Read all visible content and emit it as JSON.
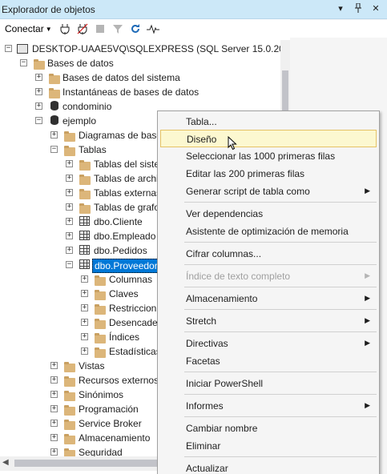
{
  "window": {
    "title": "Explorador de objetos",
    "title_icons": [
      "dropdown-icon",
      "pin-icon",
      "close-icon"
    ]
  },
  "toolbar": {
    "connect_label": "Conectar",
    "buttons": [
      "connect-plug-icon",
      "disconnect-icon",
      "stop-icon",
      "filter-icon",
      "refresh-icon",
      "activity-monitor-icon"
    ]
  },
  "tree": {
    "server": "DESKTOP-UAAE5VQ\\SQLEXPRESS (SQL Server 15.0.2000 -",
    "databases": "Bases de datos",
    "system_databases": "Bases de datos del sistema",
    "snapshots": "Instantáneas de bases de datos",
    "db_condominio": "condominio",
    "db_ejemplo": "ejemplo",
    "diagrams": "Diagramas de base",
    "tables": "Tablas",
    "system_tables": "Tablas del siste",
    "file_tables": "Tablas de archi",
    "external_tables": "Tablas externas",
    "graph_tables": "Tablas de grafo",
    "t_cliente": "dbo.Cliente",
    "t_empleado": "dbo.Empleado",
    "t_pedidos": "dbo.Pedidos",
    "t_proveedor": "dbo.Proveedor",
    "columns": "Columnas",
    "keys": "Claves",
    "constraints": "Restriccion",
    "triggers": "Desencader",
    "indexes": "Índices",
    "statistics": "Estadísticas",
    "views": "Vistas",
    "external_resources": "Recursos externos",
    "synonyms": "Sinónimos",
    "programming": "Programación",
    "service_broker": "Service Broker",
    "storage": "Almacenamiento",
    "security": "Seguridad"
  },
  "context_menu": {
    "items": [
      "Tabla...",
      "Diseño",
      "Seleccionar las 1000 primeras filas",
      "Editar las 200 primeras filas",
      "Generar script de tabla como",
      "Ver dependencias",
      "Asistente de optimización de memoria",
      "Cifrar columnas...",
      "Índice de texto completo",
      "Almacenamiento",
      "Stretch",
      "Directivas",
      "Facetas",
      "Iniciar PowerShell",
      "Informes",
      "Cambiar nombre",
      "Eliminar",
      "Actualizar"
    ],
    "highlighted": "Diseño",
    "disabled": [
      "Índice de texto completo"
    ],
    "submenus": [
      "Generar script de tabla como",
      "Índice de texto completo",
      "Almacenamiento",
      "Stretch",
      "Directivas",
      "Informes"
    ]
  },
  "colors": {
    "titlebar": "#cce8f8",
    "selection": "#0078d7",
    "menu_bg": "#f5f5f5",
    "menu_highlight": "#fcf8d0",
    "menu_highlight_border": "#e5c365",
    "folder": "#dcb67a"
  }
}
